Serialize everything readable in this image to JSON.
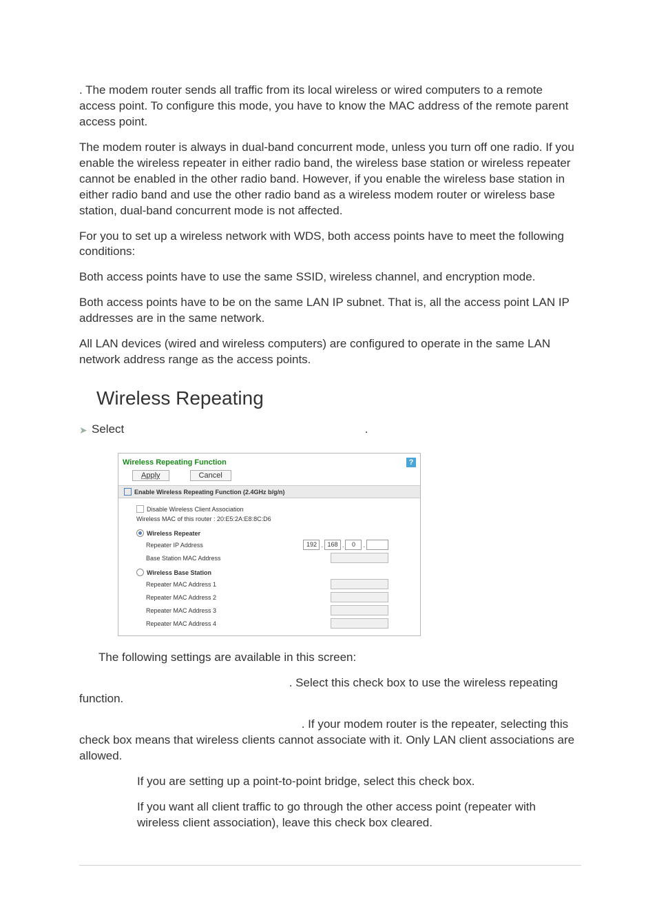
{
  "intro": {
    "para1": ". The modem router sends all traffic from its local wireless or wired computers to a remote access point. To configure this mode, you have to know the MAC address of the remote parent access point.",
    "para2": "The modem router is always in dual-band concurrent mode, unless you turn off one radio. If you enable the wireless repeater in either radio band, the wireless base station or wireless repeater cannot be enabled in the other radio band. However, if you enable the wireless base station in either radio band and use the other radio band as a wireless modem router or wireless base station, dual-band concurrent mode is not affected.",
    "para3": "For you to set up a wireless network with WDS, both access points have to meet the following conditions:",
    "bullets": [
      "Both access points have to use the same SSID, wireless channel, and encryption mode.",
      "Both access points have to be on the same LAN IP subnet. That is, all the access point LAN IP addresses are in the same network.",
      "All LAN devices (wired and wireless computers) are configured to operate in the same LAN network address range as the access points."
    ]
  },
  "heading": "Wireless Repeating",
  "step": {
    "select_prefix": "Select ",
    "select_suffix": "."
  },
  "ui": {
    "title": "Wireless Repeating Function",
    "help": "?",
    "apply": "Apply",
    "cancel": "Cancel",
    "section": "Enable Wireless Repeating Function (2.4GHz b/g/n)",
    "disable_assoc": "Disable Wireless Client Association",
    "mac_line": "Wireless MAC of this router : 20:E5:2A:E8:8C:D6",
    "repeater": "Wireless Repeater",
    "repeater_ip": "Repeater IP Address",
    "base_mac": "Base Station MAC Address",
    "base": "Wireless Base Station",
    "r1": "Repeater MAC Address 1",
    "r2": "Repeater MAC Address 2",
    "r3": "Repeater MAC Address 3",
    "r4": "Repeater MAC Address 4",
    "ip": {
      "a": "192",
      "b": "168",
      "c": "0"
    }
  },
  "after": {
    "intro": "The following settings are available in this screen:",
    "item1": ". Select this check box to use the wireless repeating function.",
    "item2": ". If your modem router is the repeater, selecting this check box means that wireless clients cannot associate with it. Only LAN client associations are allowed.",
    "sub1": "If you are setting up a point-to-point bridge, select this check box.",
    "sub2": "If you want all client traffic to go through the other access point (repeater with wireless client association), leave this check box cleared."
  }
}
